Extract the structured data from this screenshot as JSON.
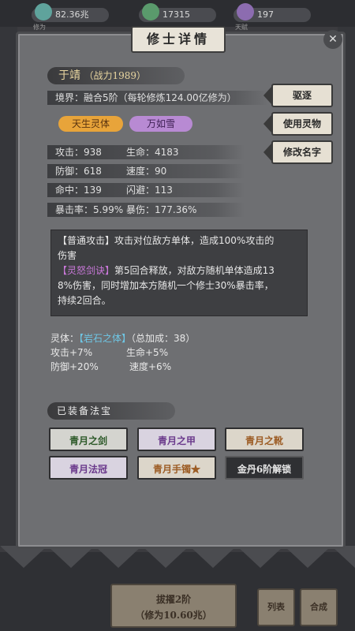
{
  "resources": [
    {
      "value": "82.36兆",
      "label": "修为",
      "color": "#5fa39c"
    },
    {
      "value": "17315",
      "label": "",
      "color": "#5a9a6c"
    },
    {
      "value": "197",
      "label": "天赋",
      "color": "#8c6cb0"
    }
  ],
  "dialog": {
    "title": "修士详情",
    "name": "于靖",
    "power_label": "（战力",
    "power_value": "1989）",
    "realm": "境界：融合5阶（每轮修炼124.00亿修为）",
    "tags": [
      {
        "label": "天生灵体",
        "bg": "#e8a43a",
        "fg": "#5a3410"
      },
      {
        "label": "万如雪",
        "bg": "#b88ad3",
        "fg": "#3c1e52"
      }
    ],
    "side_buttons": [
      "驱逐",
      "使用灵物",
      "修改名字"
    ],
    "stats": [
      {
        "a_label": "攻击：",
        "a_value": "938",
        "b_label": "生命：",
        "b_value": "4183"
      },
      {
        "a_label": "防御：",
        "a_value": "618",
        "b_label": "速度：",
        "b_value": "90"
      },
      {
        "a_label": "命中：",
        "a_value": "139",
        "b_label": "闪避：",
        "b_value": "113"
      },
      {
        "a_label": "暴击率：",
        "a_value": "5.99%",
        "b_label": "暴伤：",
        "b_value": "177.36%"
      }
    ],
    "skill": {
      "normal_tag": "【普通攻击】",
      "normal_text_1": "攻击对位敌方单体，造成100%攻击的",
      "normal_text_2": "伤害",
      "special_tag": "【灵怒剑诀】",
      "special_text_1": "第5回合释放，对敌方随机单体造成13",
      "special_text_2": "8%伤害，同时增加本方随机一个修士30%暴击率，",
      "special_text_3": "持续2回合。"
    },
    "physique": {
      "label": "灵体：",
      "name": "【岩石之体】",
      "total": "（总加成：38）",
      "bonuses": [
        {
          "a": "攻击+7%",
          "b": "生命+5%"
        },
        {
          "a": "防御+20%",
          "b": "速度+6%"
        }
      ]
    },
    "equip_section": "已装备法宝",
    "equipment": [
      {
        "label": "青月之剑",
        "style": "eq-green"
      },
      {
        "label": "青月之甲",
        "style": "eq-purple"
      },
      {
        "label": "青月之靴",
        "style": "eq-orange"
      },
      {
        "label": "青月法冠",
        "style": "eq-purple"
      },
      {
        "label": "青月手镯★",
        "style": "eq-orange"
      },
      {
        "label": "金丹6阶解锁",
        "style": "eq-dark"
      }
    ]
  },
  "bottom": {
    "main_line1": "拔擢2阶",
    "main_line2": "（修为10.60兆）",
    "list_label": "列表",
    "merge_label": "合成"
  }
}
